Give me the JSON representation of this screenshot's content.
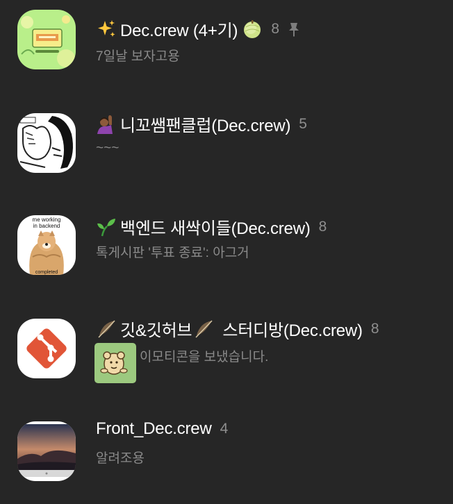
{
  "chats": [
    {
      "title": "Dec.crew (4+기)",
      "count": "8",
      "preview": "7일날 보자고용",
      "emoji": "sparkles-icon",
      "title_emoji_suffix": "melon-icon",
      "pinned": true
    },
    {
      "title": "니꼬쌤팬클럽(Dec.crew)",
      "count": "5",
      "preview": "~~~",
      "emoji": "raising-hand-icon"
    },
    {
      "title": "백엔드 새싹이들(Dec.crew)",
      "count": "8",
      "preview": "톡게시판 '투표 종료': 아그거",
      "emoji": "seedling-icon",
      "avatar_text_top": "me working",
      "avatar_text_mid": "in backend",
      "avatar_text_bottom": "completed"
    },
    {
      "title_left": "깃&깃허브",
      "title_right": "스터디방(Dec.crew)",
      "count": "8",
      "preview": "이모티콘을 보냈습니다.",
      "emoji": "feather-icon"
    },
    {
      "title": "Front_Dec.crew",
      "count": "4",
      "preview": "알려조용"
    }
  ],
  "colors": {
    "background": "#262626",
    "title": "#ffffff",
    "count": "#8e8e8e",
    "preview": "#8a8a8a",
    "git_brand": "#e15537"
  }
}
